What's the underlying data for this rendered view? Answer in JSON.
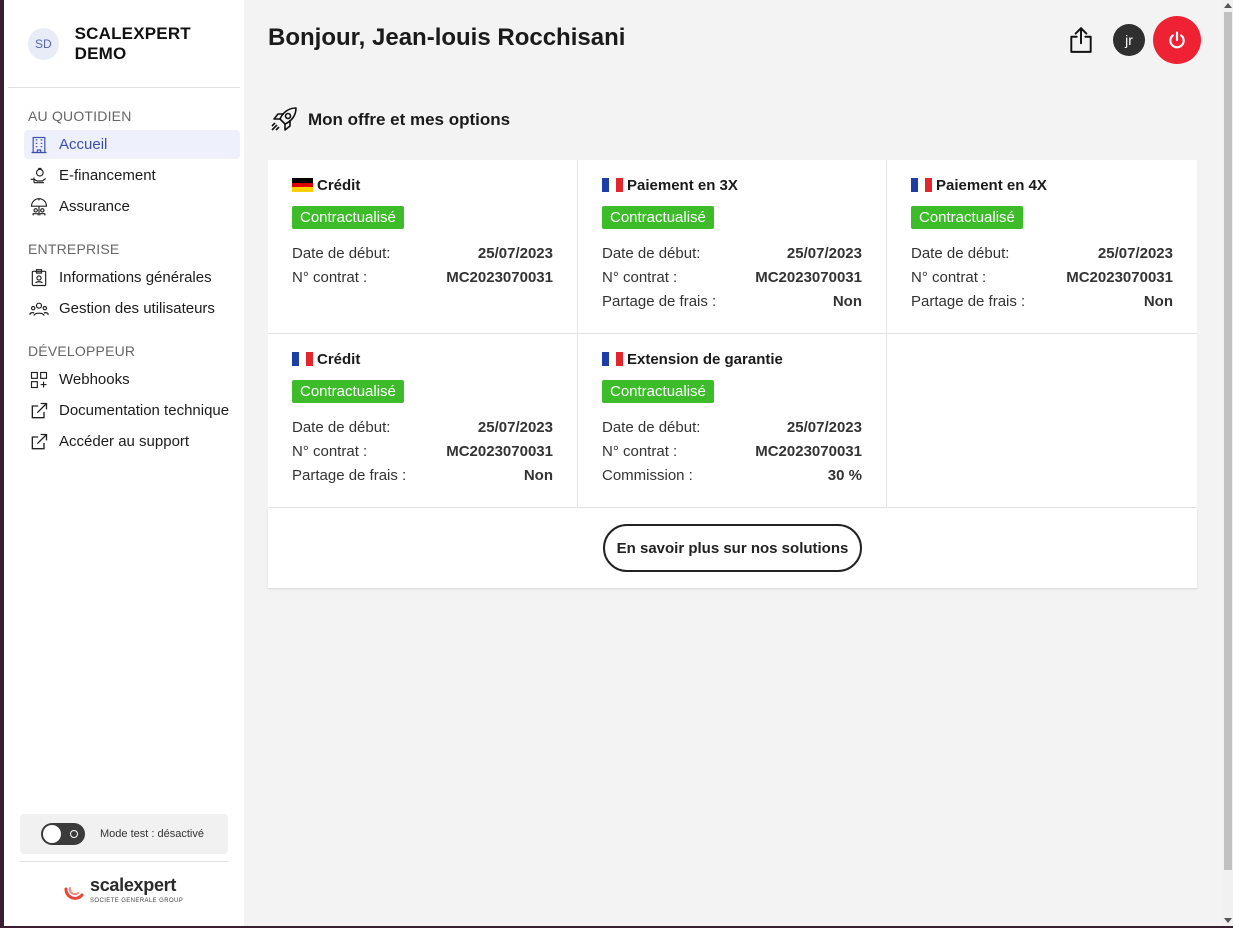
{
  "brand": {
    "initials": "SD",
    "name": "SCALEXPERT DEMO"
  },
  "nav": {
    "sections": [
      {
        "heading": "AU QUOTIDIEN",
        "items": [
          {
            "label": "Accueil",
            "icon": "building-icon",
            "active": true
          },
          {
            "label": "E-financement",
            "icon": "hand-money-icon"
          },
          {
            "label": "Assurance",
            "icon": "umbrella-icon"
          }
        ]
      },
      {
        "heading": "ENTREPRISE",
        "items": [
          {
            "label": "Informations générales",
            "icon": "id-badge-icon"
          },
          {
            "label": "Gestion des utilisateurs",
            "icon": "users-icon"
          }
        ]
      },
      {
        "heading": "DÉVELOPPEUR",
        "items": [
          {
            "label": "Webhooks",
            "icon": "webhooks-icon"
          },
          {
            "label": "Documentation technique",
            "icon": "external-link-icon"
          },
          {
            "label": "Accéder au support",
            "icon": "external-link-icon"
          }
        ]
      }
    ]
  },
  "test_mode": {
    "label": "Mode test : désactivé",
    "enabled": false
  },
  "logo": {
    "name": "scalexpert",
    "sub": "SOCIETE GENERALE GROUP"
  },
  "header": {
    "greeting": "Bonjour, Jean-louis Rocchisani",
    "user_initials": "jr"
  },
  "section": {
    "title": "Mon offre et mes options"
  },
  "offers": [
    {
      "flag": "de",
      "title": "Crédit",
      "status": "Contractualisé",
      "rows": [
        {
          "label": "Date de début:",
          "value": "25/07/2023"
        },
        {
          "label": "N° contrat :",
          "value": "MC2023070031"
        }
      ]
    },
    {
      "flag": "fr",
      "title": "Paiement en 3X",
      "status": "Contractualisé",
      "rows": [
        {
          "label": "Date de début:",
          "value": "25/07/2023"
        },
        {
          "label": "N° contrat :",
          "value": "MC2023070031"
        },
        {
          "label": "Partage de frais :",
          "value": "Non"
        }
      ]
    },
    {
      "flag": "fr",
      "title": "Paiement en 4X",
      "status": "Contractualisé",
      "rows": [
        {
          "label": "Date de début:",
          "value": "25/07/2023"
        },
        {
          "label": "N° contrat :",
          "value": "MC2023070031"
        },
        {
          "label": "Partage de frais :",
          "value": "Non"
        }
      ]
    },
    {
      "flag": "fr",
      "title": "Crédit",
      "status": "Contractualisé",
      "rows": [
        {
          "label": "Date de début:",
          "value": "25/07/2023"
        },
        {
          "label": "N° contrat :",
          "value": "MC2023070031"
        },
        {
          "label": "Partage de frais :",
          "value": "Non"
        }
      ]
    },
    {
      "flag": "fr",
      "title": "Extension de garantie",
      "status": "Contractualisé",
      "rows": [
        {
          "label": "Date de début:",
          "value": "25/07/2023"
        },
        {
          "label": "N° contrat :",
          "value": "MC2023070031"
        },
        {
          "label": "Commission :",
          "value": "30 %"
        }
      ]
    }
  ],
  "more_button": "En savoir plus sur nos solutions",
  "colors": {
    "accent": "#3a4fae",
    "success": "#3dbc2a",
    "danger": "#ee2233"
  }
}
